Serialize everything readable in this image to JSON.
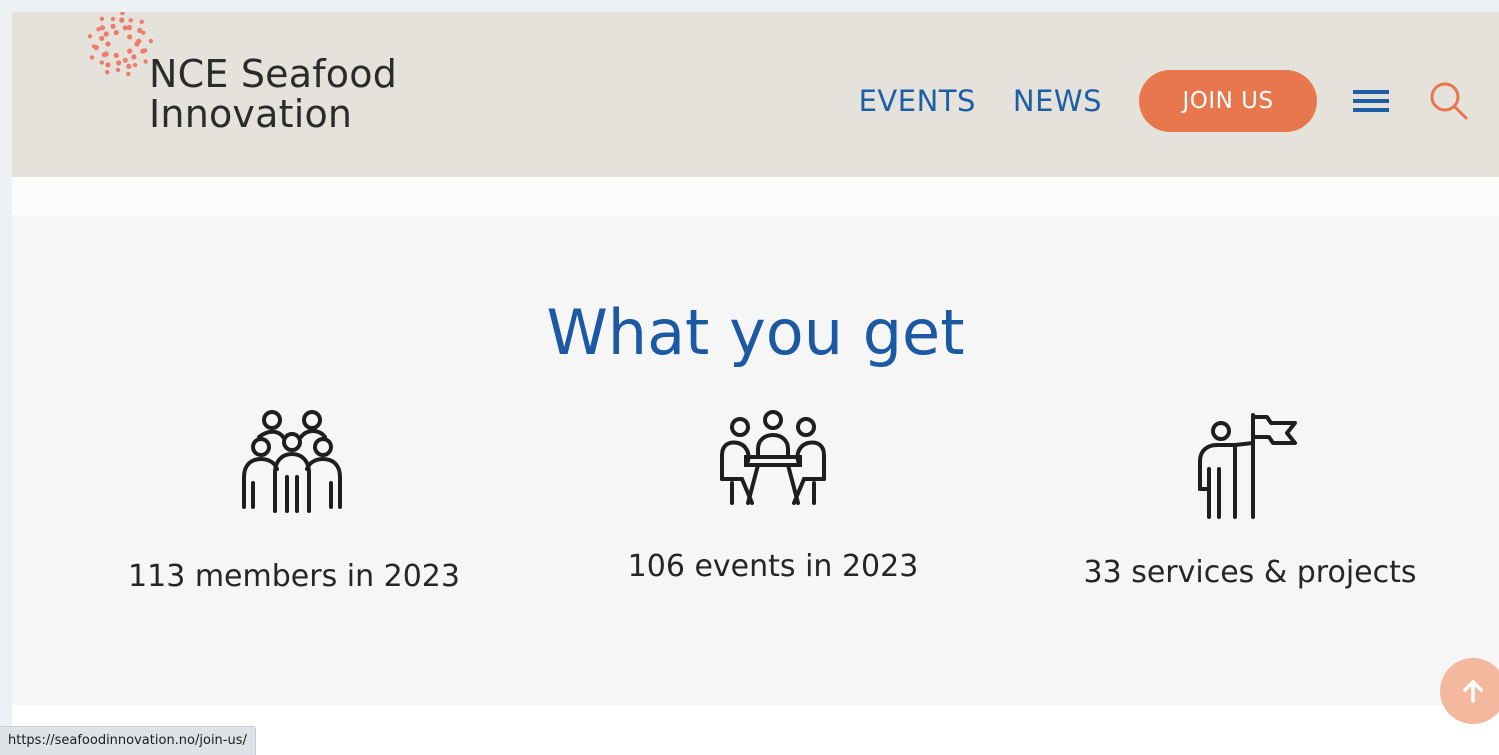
{
  "header": {
    "logo_line1": "NCE Seafood",
    "logo_line2": "Innovation",
    "nav_events": "EVENTS",
    "nav_news": "NEWS",
    "join_label": "JOIN US",
    "menu_icon": "hamburger-menu-icon",
    "search_icon": "search-icon"
  },
  "section": {
    "title": "What you get",
    "stats": [
      {
        "icon": "group-of-people-icon",
        "label": "113 members in 2023"
      },
      {
        "icon": "people-meeting-at-table-icon",
        "label": "106 events in 2023"
      },
      {
        "icon": "person-with-flag-icon",
        "label": "33 services & projects"
      }
    ]
  },
  "status_bar": {
    "url": "https://seafoodinnovation.no/join-us/"
  },
  "back_to_top_icon": "arrow-up-icon",
  "colors": {
    "header_bg": "#e5e2db",
    "nav_blue": "#1d5fa6",
    "accent_orange": "#e8774e",
    "title_blue": "#1b59a4",
    "logo_dots": "#ef7b6a"
  }
}
